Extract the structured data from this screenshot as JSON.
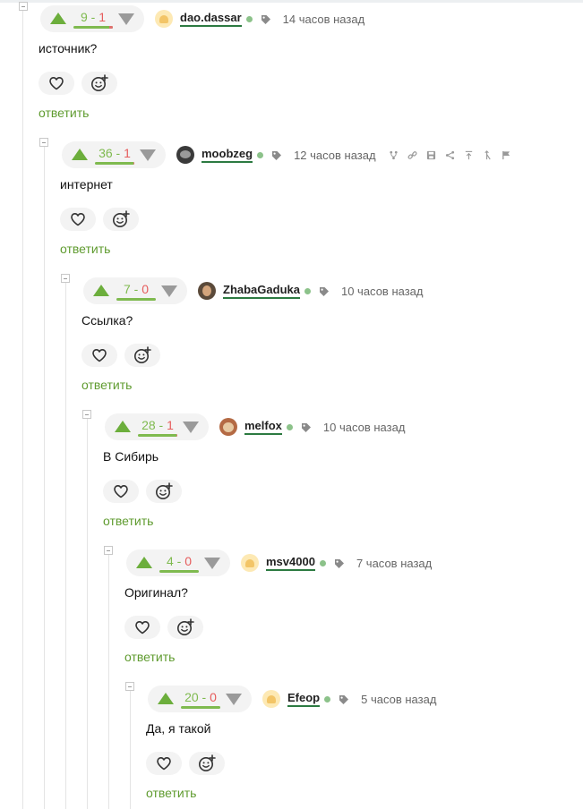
{
  "reply_label": "ответить",
  "colors": {
    "upvote": "#6cae3c",
    "positive": "#7fba4f",
    "negative": "#e65c5c",
    "username_underline": "#2c7a41",
    "online": "#8cc28a",
    "reply": "#5f9b2f"
  },
  "icons": {
    "upvote": "triangle-up-icon",
    "downvote": "triangle-down-icon",
    "tag": "tag-icon",
    "like": "heart-icon",
    "reaction": "emoji-add-icon"
  },
  "comments": [
    {
      "user": "dao.dassar",
      "plus": "9",
      "minus": "1",
      "rating_fraction": 0.9,
      "time": "14 часов назад",
      "text": "источник?",
      "avatar": "ghost"
    },
    {
      "user": "moobzeg",
      "plus": "36",
      "minus": "1",
      "rating_fraction": 0.973,
      "time": "12 часов назад",
      "text": "интернет",
      "avatar": "cat",
      "tools": [
        "branch-icon",
        "link-icon",
        "save-icon",
        "share-icon",
        "go-to-parent-icon",
        "pin-icon",
        "flag-icon"
      ]
    },
    {
      "user": "ZhabaGaduka",
      "plus": "7",
      "minus": "0",
      "rating_fraction": 1.0,
      "time": "10 часов назад",
      "text": "Ссылка?",
      "avatar": "man"
    },
    {
      "user": "melfox",
      "plus": "28",
      "minus": "1",
      "rating_fraction": 0.966,
      "time": "10 часов назад",
      "text": "В Сибирь",
      "avatar": "fox"
    },
    {
      "user": "msv4000",
      "plus": "4",
      "minus": "0",
      "rating_fraction": 1.0,
      "time": "7 часов назад",
      "text": "Оригинал?",
      "avatar": "ghost"
    },
    {
      "user": "Efeop",
      "plus": "20",
      "minus": "0",
      "rating_fraction": 1.0,
      "time": "5 часов назад",
      "text": "Да, я такой",
      "avatar": "ghost"
    }
  ]
}
